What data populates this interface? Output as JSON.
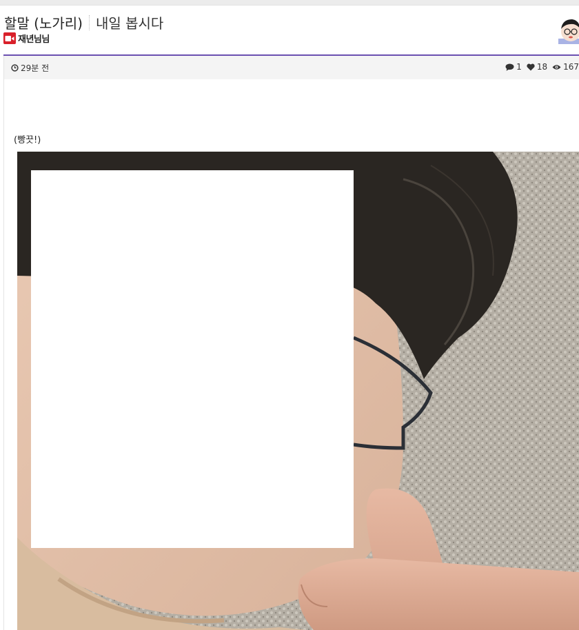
{
  "post": {
    "board": "할말 (노가리)",
    "title": "내일 봅시다",
    "author": "재년님님",
    "time_ago": "29분 전",
    "body_text": "(빵끗!)"
  },
  "stats": {
    "comments": "1",
    "likes": "18",
    "views": "167"
  },
  "icons": {
    "author_badge": "camera-icon",
    "time": "clock-icon",
    "comments": "comment-icon",
    "likes": "heart-icon",
    "views": "eye-icon"
  },
  "colors": {
    "accent_line": "#6a4fb0",
    "author_badge": "#d9202a",
    "meta_bar_bg": "#f4f4f4"
  }
}
